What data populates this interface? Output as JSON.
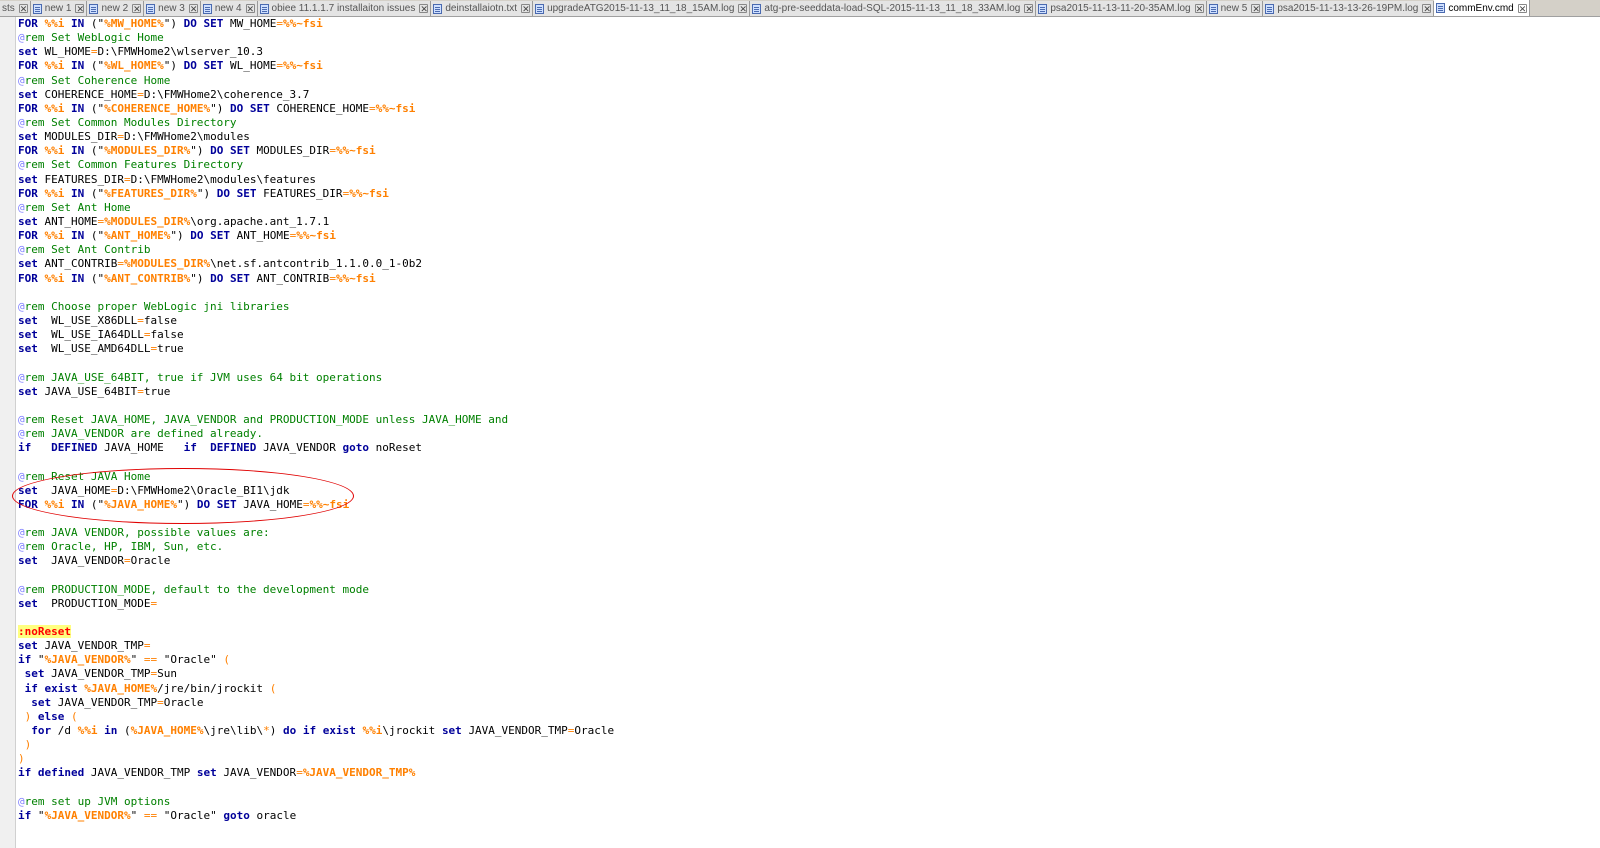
{
  "tabs": [
    {
      "label": "sts",
      "active": false,
      "icon": "file-icon"
    },
    {
      "label": "new 1",
      "active": false,
      "icon": "file-icon"
    },
    {
      "label": "new 2",
      "active": false,
      "icon": "file-icon"
    },
    {
      "label": "new 3",
      "active": false,
      "icon": "file-icon"
    },
    {
      "label": "new 4",
      "active": false,
      "icon": "file-icon"
    },
    {
      "label": "obiee 11.1.1.7 installaiton issues",
      "active": false,
      "icon": "file-icon"
    },
    {
      "label": "deinstallaiotn.txt",
      "active": false,
      "icon": "file-icon"
    },
    {
      "label": "upgradeATG2015-11-13_11_18_15AM.log",
      "active": false,
      "icon": "file-icon"
    },
    {
      "label": "atg-pre-seeddata-load-SQL-2015-11-13_11_18_33AM.log",
      "active": false,
      "icon": "file-icon"
    },
    {
      "label": "psa2015-11-13-11-20-35AM.log",
      "active": false,
      "icon": "file-icon"
    },
    {
      "label": "new 5",
      "active": false,
      "icon": "file-icon"
    },
    {
      "label": "psa2015-11-13-13-26-19PM.log",
      "active": false,
      "icon": "file-icon"
    },
    {
      "label": "commEnv.cmd",
      "active": true,
      "icon": "file-icon"
    }
  ],
  "close_glyph": "✕",
  "colors": {
    "keyword": "#00009a",
    "comment": "#008000",
    "variable": "#ff8000",
    "label_bg": "#ffff80",
    "annotation": "#e00000"
  },
  "lines": [
    [
      [
        "kw",
        "FOR "
      ],
      [
        "var",
        "%%i"
      ],
      [
        "kw",
        " IN "
      ],
      [
        "t",
        "(\""
      ],
      [
        "var",
        "%MW_HOME%"
      ],
      [
        "t",
        "\") "
      ],
      [
        "kw",
        "DO SET "
      ],
      [
        "t",
        "MW_HOME"
      ],
      [
        "op",
        "="
      ],
      [
        "var",
        "%%~fsi"
      ]
    ],
    [
      [
        "at",
        "@"
      ],
      [
        "cm",
        "rem Set WebLogic Home"
      ]
    ],
    [
      [
        "kw",
        "set "
      ],
      [
        "t",
        "WL_HOME"
      ],
      [
        "op",
        "="
      ],
      [
        "t",
        "D:\\FMWHome2\\wlserver_10.3"
      ]
    ],
    [
      [
        "kw",
        "FOR "
      ],
      [
        "var",
        "%%i"
      ],
      [
        "kw",
        " IN "
      ],
      [
        "t",
        "(\""
      ],
      [
        "var",
        "%WL_HOME%"
      ],
      [
        "t",
        "\") "
      ],
      [
        "kw",
        "DO SET "
      ],
      [
        "t",
        "WL_HOME"
      ],
      [
        "op",
        "="
      ],
      [
        "var",
        "%%~fsi"
      ]
    ],
    [
      [
        "at",
        "@"
      ],
      [
        "cm",
        "rem Set Coherence Home"
      ]
    ],
    [
      [
        "kw",
        "set "
      ],
      [
        "t",
        "COHERENCE_HOME"
      ],
      [
        "op",
        "="
      ],
      [
        "t",
        "D:\\FMWHome2\\coherence_3.7"
      ]
    ],
    [
      [
        "kw",
        "FOR "
      ],
      [
        "var",
        "%%i"
      ],
      [
        "kw",
        " IN "
      ],
      [
        "t",
        "(\""
      ],
      [
        "var",
        "%COHERENCE_HOME%"
      ],
      [
        "t",
        "\") "
      ],
      [
        "kw",
        "DO SET "
      ],
      [
        "t",
        "COHERENCE_HOME"
      ],
      [
        "op",
        "="
      ],
      [
        "var",
        "%%~fsi"
      ]
    ],
    [
      [
        "at",
        "@"
      ],
      [
        "cm",
        "rem Set Common Modules Directory"
      ]
    ],
    [
      [
        "kw",
        "set "
      ],
      [
        "t",
        "MODULES_DIR"
      ],
      [
        "op",
        "="
      ],
      [
        "t",
        "D:\\FMWHome2\\modules"
      ]
    ],
    [
      [
        "kw",
        "FOR "
      ],
      [
        "var",
        "%%i"
      ],
      [
        "kw",
        " IN "
      ],
      [
        "t",
        "(\""
      ],
      [
        "var",
        "%MODULES_DIR%"
      ],
      [
        "t",
        "\") "
      ],
      [
        "kw",
        "DO SET "
      ],
      [
        "t",
        "MODULES_DIR"
      ],
      [
        "op",
        "="
      ],
      [
        "var",
        "%%~fsi"
      ]
    ],
    [
      [
        "at",
        "@"
      ],
      [
        "cm",
        "rem Set Common Features Directory"
      ]
    ],
    [
      [
        "kw",
        "set "
      ],
      [
        "t",
        "FEATURES_DIR"
      ],
      [
        "op",
        "="
      ],
      [
        "t",
        "D:\\FMWHome2\\modules\\features"
      ]
    ],
    [
      [
        "kw",
        "FOR "
      ],
      [
        "var",
        "%%i"
      ],
      [
        "kw",
        " IN "
      ],
      [
        "t",
        "(\""
      ],
      [
        "var",
        "%FEATURES_DIR%"
      ],
      [
        "t",
        "\") "
      ],
      [
        "kw",
        "DO SET "
      ],
      [
        "t",
        "FEATURES_DIR"
      ],
      [
        "op",
        "="
      ],
      [
        "var",
        "%%~fsi"
      ]
    ],
    [
      [
        "at",
        "@"
      ],
      [
        "cm",
        "rem Set Ant Home"
      ]
    ],
    [
      [
        "kw",
        "set "
      ],
      [
        "t",
        "ANT_HOME"
      ],
      [
        "op",
        "="
      ],
      [
        "var",
        "%MODULES_DIR%"
      ],
      [
        "t",
        "\\org.apache.ant_1.7.1"
      ]
    ],
    [
      [
        "kw",
        "FOR "
      ],
      [
        "var",
        "%%i"
      ],
      [
        "kw",
        " IN "
      ],
      [
        "t",
        "(\""
      ],
      [
        "var",
        "%ANT_HOME%"
      ],
      [
        "t",
        "\") "
      ],
      [
        "kw",
        "DO SET "
      ],
      [
        "t",
        "ANT_HOME"
      ],
      [
        "op",
        "="
      ],
      [
        "var",
        "%%~fsi"
      ]
    ],
    [
      [
        "at",
        "@"
      ],
      [
        "cm",
        "rem Set Ant Contrib"
      ]
    ],
    [
      [
        "kw",
        "set "
      ],
      [
        "t",
        "ANT_CONTRIB"
      ],
      [
        "op",
        "="
      ],
      [
        "var",
        "%MODULES_DIR%"
      ],
      [
        "t",
        "\\net.sf.antcontrib_1.1.0.0_1-0b2"
      ]
    ],
    [
      [
        "kw",
        "FOR "
      ],
      [
        "var",
        "%%i"
      ],
      [
        "kw",
        " IN "
      ],
      [
        "t",
        "(\""
      ],
      [
        "var",
        "%ANT_CONTRIB%"
      ],
      [
        "t",
        "\") "
      ],
      [
        "kw",
        "DO SET "
      ],
      [
        "t",
        "ANT_CONTRIB"
      ],
      [
        "op",
        "="
      ],
      [
        "var",
        "%%~fsi"
      ]
    ],
    [],
    [
      [
        "at",
        "@"
      ],
      [
        "cm",
        "rem Choose proper WebLogic jni libraries"
      ]
    ],
    [
      [
        "kw",
        "set "
      ],
      [
        "t",
        " WL_USE_X86DLL"
      ],
      [
        "op",
        "="
      ],
      [
        "t",
        "false"
      ]
    ],
    [
      [
        "kw",
        "set "
      ],
      [
        "t",
        " WL_USE_IA64DLL"
      ],
      [
        "op",
        "="
      ],
      [
        "t",
        "false"
      ]
    ],
    [
      [
        "kw",
        "set "
      ],
      [
        "t",
        " WL_USE_AMD64DLL"
      ],
      [
        "op",
        "="
      ],
      [
        "t",
        "true"
      ]
    ],
    [],
    [
      [
        "at",
        "@"
      ],
      [
        "cm",
        "rem JAVA_USE_64BIT, true if JVM uses 64 bit operations"
      ]
    ],
    [
      [
        "kw",
        "set "
      ],
      [
        "t",
        "JAVA_USE_64BIT"
      ],
      [
        "op",
        "="
      ],
      [
        "t",
        "true"
      ]
    ],
    [],
    [
      [
        "at",
        "@"
      ],
      [
        "cm",
        "rem Reset JAVA_HOME, JAVA_VENDOR and PRODUCTION_MODE unless JAVA_HOME and"
      ]
    ],
    [
      [
        "at",
        "@"
      ],
      [
        "cm",
        "rem JAVA_VENDOR are defined already."
      ]
    ],
    [
      [
        "kw",
        "if   DEFINED "
      ],
      [
        "t",
        "JAVA_HOME   "
      ],
      [
        "kw",
        "if  DEFINED "
      ],
      [
        "t",
        "JAVA_VENDOR "
      ],
      [
        "kw",
        "goto "
      ],
      [
        "t",
        "noReset"
      ]
    ],
    [],
    [
      [
        "at",
        "@"
      ],
      [
        "cm",
        "rem Reset JAVA Home"
      ]
    ],
    [
      [
        "kw",
        "set "
      ],
      [
        "t",
        " JAVA_HOME"
      ],
      [
        "op",
        "="
      ],
      [
        "t",
        "D:\\FMWHome2\\Oracle_BI1\\jdk"
      ]
    ],
    [
      [
        "kw",
        "FOR "
      ],
      [
        "var",
        "%%i"
      ],
      [
        "kw",
        " IN "
      ],
      [
        "t",
        "(\""
      ],
      [
        "var",
        "%JAVA_HOME%"
      ],
      [
        "t",
        "\") "
      ],
      [
        "kw",
        "DO SET "
      ],
      [
        "t",
        "JAVA_HOME"
      ],
      [
        "op",
        "="
      ],
      [
        "var",
        "%%~fsi"
      ]
    ],
    [],
    [
      [
        "at",
        "@"
      ],
      [
        "cm",
        "rem JAVA VENDOR, possible values are:"
      ]
    ],
    [
      [
        "at",
        "@"
      ],
      [
        "cm",
        "rem Oracle, HP, IBM, Sun, etc."
      ]
    ],
    [
      [
        "kw",
        "set "
      ],
      [
        "t",
        " JAVA_VENDOR"
      ],
      [
        "op",
        "="
      ],
      [
        "t",
        "Oracle"
      ]
    ],
    [],
    [
      [
        "at",
        "@"
      ],
      [
        "cm",
        "rem PRODUCTION_MODE, default to the development mode"
      ]
    ],
    [
      [
        "kw",
        "set "
      ],
      [
        "t",
        " PRODUCTION_MODE"
      ],
      [
        "op",
        "="
      ]
    ],
    [],
    [
      [
        "lbl",
        ":noReset"
      ]
    ],
    [
      [
        "kw",
        "set "
      ],
      [
        "t",
        "JAVA_VENDOR_TMP"
      ],
      [
        "op",
        "="
      ]
    ],
    [
      [
        "kw",
        "if "
      ],
      [
        "t",
        "\""
      ],
      [
        "var",
        "%JAVA_VENDOR%"
      ],
      [
        "t",
        "\" "
      ],
      [
        "op",
        "=="
      ],
      [
        "t",
        " \"Oracle\" "
      ],
      [
        "op",
        "("
      ]
    ],
    [
      [
        "t",
        " "
      ],
      [
        "kw",
        "set "
      ],
      [
        "t",
        "JAVA_VENDOR_TMP"
      ],
      [
        "op",
        "="
      ],
      [
        "t",
        "Sun"
      ]
    ],
    [
      [
        "t",
        " "
      ],
      [
        "kw",
        "if exist "
      ],
      [
        "var",
        "%JAVA_HOME%"
      ],
      [
        "t",
        "/jre/bin/jrockit "
      ],
      [
        "op",
        "("
      ]
    ],
    [
      [
        "t",
        "  "
      ],
      [
        "kw",
        "set "
      ],
      [
        "t",
        "JAVA_VENDOR_TMP"
      ],
      [
        "op",
        "="
      ],
      [
        "t",
        "Oracle"
      ]
    ],
    [
      [
        "t",
        " "
      ],
      [
        "op",
        ")"
      ],
      [
        "kw",
        " else "
      ],
      [
        "op",
        "("
      ]
    ],
    [
      [
        "t",
        "  "
      ],
      [
        "kw",
        "for "
      ],
      [
        "t",
        "/d "
      ],
      [
        "var",
        "%%i"
      ],
      [
        "kw",
        " in "
      ],
      [
        "t",
        "("
      ],
      [
        "var",
        "%JAVA_HOME%"
      ],
      [
        "t",
        "\\jre\\lib\\"
      ],
      [
        "op",
        "*"
      ],
      [
        "t",
        ") "
      ],
      [
        "kw",
        "do if exist "
      ],
      [
        "var",
        "%%i"
      ],
      [
        "t",
        "\\jrockit "
      ],
      [
        "kw",
        "set "
      ],
      [
        "t",
        "JAVA_VENDOR_TMP"
      ],
      [
        "op",
        "="
      ],
      [
        "t",
        "Oracle"
      ]
    ],
    [
      [
        "t",
        " "
      ],
      [
        "op",
        ")"
      ]
    ],
    [
      [
        "op",
        ")"
      ]
    ],
    [
      [
        "kw",
        "if defined "
      ],
      [
        "t",
        "JAVA_VENDOR_TMP "
      ],
      [
        "kw",
        "set "
      ],
      [
        "t",
        "JAVA_VENDOR"
      ],
      [
        "op",
        "="
      ],
      [
        "var",
        "%JAVA_VENDOR_TMP%"
      ]
    ],
    [],
    [
      [
        "at",
        "@"
      ],
      [
        "cm",
        "rem set up JVM options"
      ]
    ],
    [
      [
        "kw",
        "if "
      ],
      [
        "t",
        "\""
      ],
      [
        "var",
        "%JAVA_VENDOR%"
      ],
      [
        "t",
        "\" "
      ],
      [
        "op",
        "=="
      ],
      [
        "t",
        " \"Oracle\" "
      ],
      [
        "kw",
        "goto "
      ],
      [
        "t",
        "oracle"
      ]
    ]
  ]
}
